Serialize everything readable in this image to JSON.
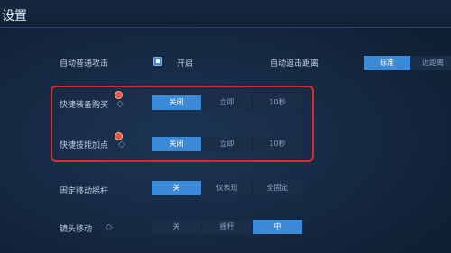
{
  "header": {
    "title": "设置"
  },
  "settings": {
    "auto_attack": {
      "label": "自动普通攻击",
      "checkbox_label": "开启",
      "checked": true
    },
    "auto_track_distance": {
      "label": "自动追击距离",
      "options": [
        "标准",
        "近距离"
      ],
      "selected": 0
    },
    "quick_buy": {
      "label": "快捷装备购买",
      "options": [
        "关闭",
        "立即",
        "10秒"
      ],
      "selected": 0
    },
    "quick_skill": {
      "label": "快捷技能加点",
      "options": [
        "关闭",
        "立即",
        "10秒"
      ],
      "selected": 0
    },
    "fixed_joystick": {
      "label": "固定移动摇杆",
      "options": [
        "关",
        "仅表现",
        "全固定"
      ],
      "selected": 0
    },
    "camera_move": {
      "label": "镜头移动",
      "options": [
        "关",
        "摇杆",
        "中"
      ],
      "selected": 2
    }
  },
  "colors": {
    "accent": "#3b8ad8",
    "highlight_border": "#d22e2e",
    "background": "#14273f"
  }
}
